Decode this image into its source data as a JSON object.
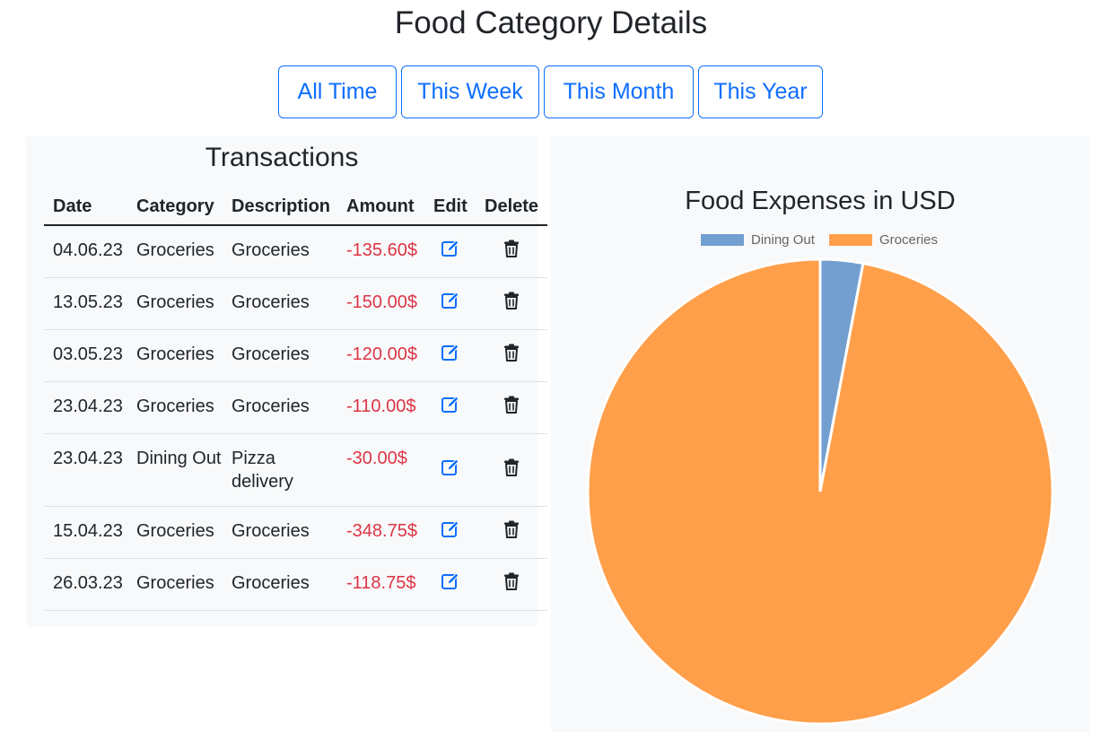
{
  "page": {
    "title": "Food Category Details"
  },
  "range_buttons": [
    {
      "label": "All Time",
      "active": true
    },
    {
      "label": "This Week",
      "active": false
    },
    {
      "label": "This Month",
      "active": false
    },
    {
      "label": "This Year",
      "active": false
    }
  ],
  "transactions": {
    "title": "Transactions",
    "columns": [
      "Date",
      "Category",
      "Description",
      "Amount",
      "Edit",
      "Delete"
    ],
    "rows": [
      {
        "date": "04.06.23",
        "category": "Groceries",
        "description": "Groceries",
        "amount": "-135.60$"
      },
      {
        "date": "13.05.23",
        "category": "Groceries",
        "description": "Groceries",
        "amount": "-150.00$"
      },
      {
        "date": "03.05.23",
        "category": "Groceries",
        "description": "Groceries",
        "amount": "-120.00$"
      },
      {
        "date": "23.04.23",
        "category": "Groceries",
        "description": "Groceries",
        "amount": "-110.00$"
      },
      {
        "date": "23.04.23",
        "category": "Dining Out",
        "description": "Pizza delivery",
        "amount": "-30.00$"
      },
      {
        "date": "15.04.23",
        "category": "Groceries",
        "description": "Groceries",
        "amount": "-348.75$"
      },
      {
        "date": "26.03.23",
        "category": "Groceries",
        "description": "Groceries",
        "amount": "-118.75$"
      }
    ],
    "edit_icon": "edit-icon",
    "delete_icon": "trash-icon"
  },
  "colors": {
    "primary": "#0d6efd",
    "negative_amount": "#dc3545",
    "panel_bg": "#f8f9fa"
  },
  "chart_data": {
    "type": "pie",
    "title": "Food Expenses in USD",
    "legend_position": "top",
    "categories": [
      "Dining Out",
      "Groceries"
    ],
    "values": [
      30.0,
      983.1
    ],
    "colors": [
      "#729fcf",
      "#ff9f4a"
    ]
  }
}
